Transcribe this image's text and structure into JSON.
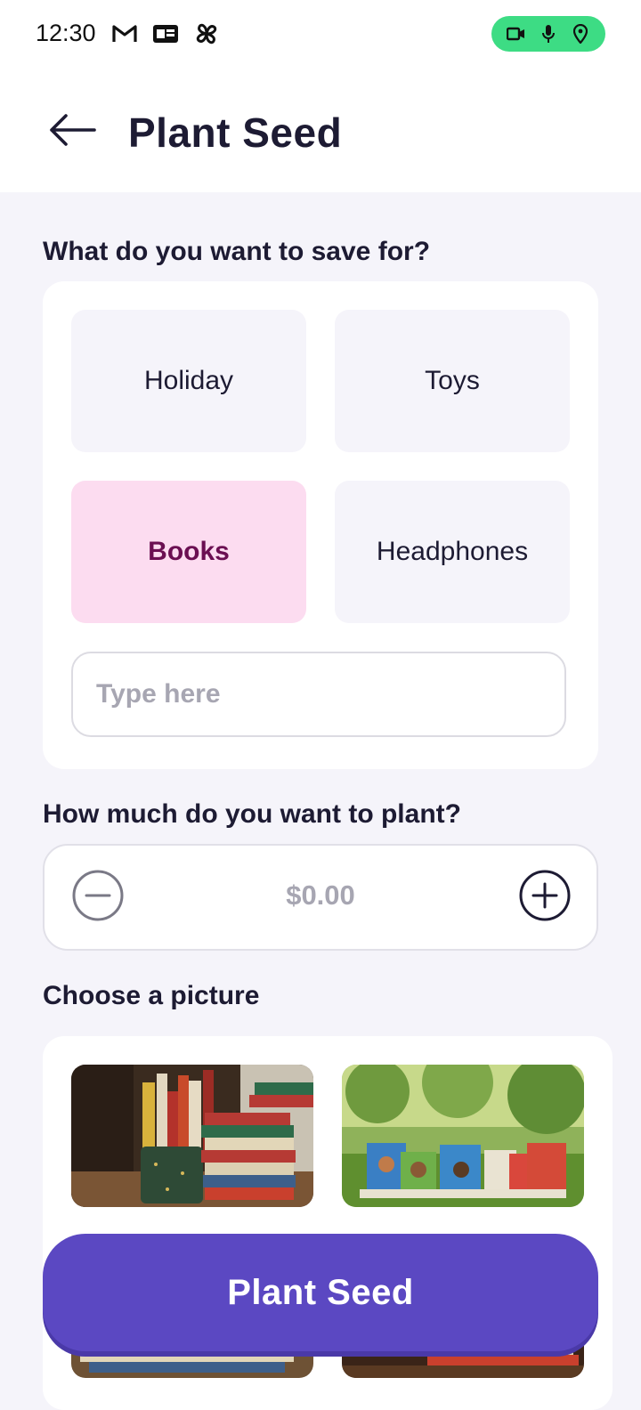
{
  "status_bar": {
    "time": "12:30",
    "icons": [
      "gmail-icon",
      "news-icon",
      "pinwheel-icon"
    ],
    "privacy_icons": [
      "camera-icon",
      "mic-icon",
      "location-icon"
    ],
    "privacy_color": "#3ddc84"
  },
  "header": {
    "title": "Plant Seed",
    "back_icon": "arrow-left-icon"
  },
  "save_for": {
    "label": "What do you want to save for?",
    "options": [
      {
        "label": "Holiday",
        "selected": false
      },
      {
        "label": "Toys",
        "selected": false
      },
      {
        "label": "Books",
        "selected": true
      },
      {
        "label": "Headphones",
        "selected": false
      }
    ],
    "input_placeholder": "Type here",
    "input_value": ""
  },
  "amount": {
    "label": "How much do you want to plant?",
    "value": "$0.00",
    "minus_icon": "minus-circle-icon",
    "plus_icon": "plus-circle-icon"
  },
  "picture": {
    "label": "Choose a picture",
    "images": [
      "books-in-pencil-cup-image",
      "picture-books-on-grass-image",
      "book-stack-image",
      "book-stack-on-table-image"
    ]
  },
  "primary_action": {
    "label": "Plant Seed",
    "color": "#5b48c2"
  },
  "colors": {
    "background": "#f5f4fa",
    "selected_tile": "#fcdcf0",
    "selected_text": "#6b0f52",
    "text": "#1d1b33"
  }
}
